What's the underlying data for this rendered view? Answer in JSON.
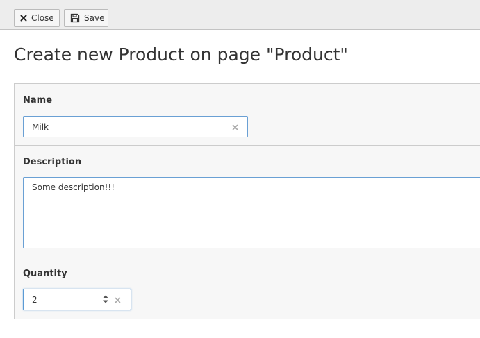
{
  "toolbar": {
    "close_label": "Close",
    "save_label": "Save"
  },
  "page": {
    "title": "Create new Product on page \"Product\""
  },
  "form": {
    "name": {
      "label": "Name",
      "value": "Milk"
    },
    "description": {
      "label": "Description",
      "value": "Some description!!!"
    },
    "quantity": {
      "label": "Quantity",
      "value": "2"
    }
  },
  "icons": {
    "close": "close-icon",
    "save": "save-icon",
    "clear": "clear-icon",
    "spinner": "spinner-icon"
  },
  "colors": {
    "toolbar_bg": "#ededed",
    "focus_border": "#6aa0d4",
    "panel_bg": "#f7f7f7"
  }
}
